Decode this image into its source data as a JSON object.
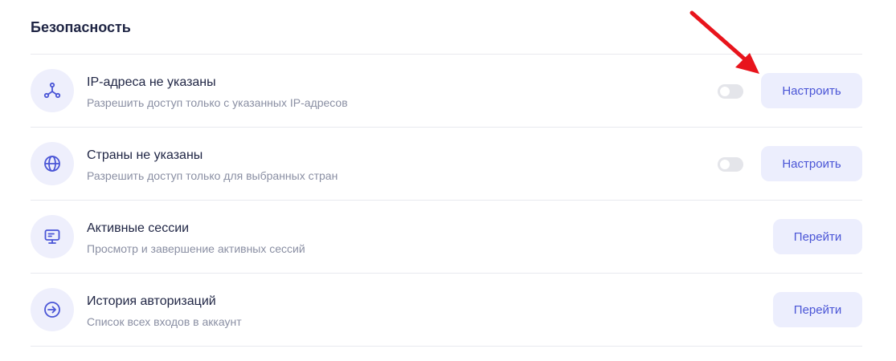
{
  "section": {
    "title": "Безопасность"
  },
  "rows": [
    {
      "title": "IP-адреса не указаны",
      "desc": "Разрешить доступ только с указанных IP-адресов",
      "button": "Настроить",
      "icon": "network-nodes-icon"
    },
    {
      "title": "Страны не указаны",
      "desc": "Разрешить доступ только для выбранных стран",
      "button": "Настроить",
      "icon": "globe-icon"
    },
    {
      "title": "Активные сессии",
      "desc": "Просмотр и завершение активных сессий",
      "button": "Перейти",
      "icon": "monitor-icon"
    },
    {
      "title": "История авторизаций",
      "desc": "Список всех входов в аккаунт",
      "button": "Перейти",
      "icon": "login-icon"
    }
  ],
  "toggles": [
    {
      "enabled": false
    },
    {
      "enabled": false
    }
  ],
  "colors": {
    "accent": "#4a55d6",
    "icon_bg": "#eeeffc",
    "button_bg": "#eceefd",
    "arrow": "#e8141c"
  }
}
